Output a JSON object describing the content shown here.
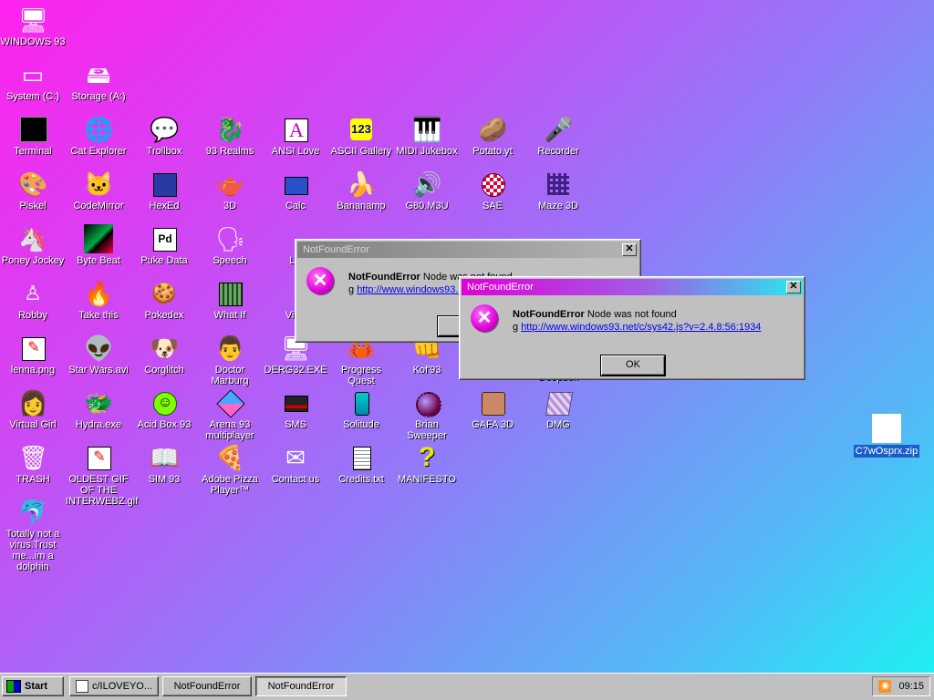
{
  "desktop": {
    "icons": [
      {
        "label": "WINDOWS 93",
        "glyph": "🖥"
      },
      {
        "label": "System (C:)",
        "glyph": "▭"
      },
      {
        "label": "Storage (A:)",
        "glyph": "🖴"
      },
      {
        "label": "Terminal",
        "glyph": "▮"
      },
      {
        "label": "Cat Explorer",
        "glyph": "🌐"
      },
      {
        "label": "Trollbox",
        "glyph": "💬"
      },
      {
        "label": "93 Realms",
        "glyph": "🐉"
      },
      {
        "label": "ANSI Love",
        "glyph": "A"
      },
      {
        "label": "ASCII Gallery",
        "glyph": "123"
      },
      {
        "label": "MIDI Jukebox",
        "glyph": "🎹"
      },
      {
        "label": "Potato.yt",
        "glyph": "🥔"
      },
      {
        "label": "Recorder",
        "glyph": "🎤"
      },
      {
        "label": "Piskel",
        "glyph": "🎨"
      },
      {
        "label": "CodeMirror",
        "glyph": "🐱"
      },
      {
        "label": "HexEd",
        "glyph": "⬢"
      },
      {
        "label": "3D",
        "glyph": "🫖"
      },
      {
        "label": "Calc",
        "glyph": "🖩"
      },
      {
        "label": "Bananamp",
        "glyph": "🍌"
      },
      {
        "label": "G80.M3U",
        "glyph": "🔊"
      },
      {
        "label": "SAE",
        "glyph": "⚽"
      },
      {
        "label": "Maze 3D",
        "glyph": "▦"
      },
      {
        "label": "Poney Jockey",
        "glyph": "🦄"
      },
      {
        "label": "Byte Beat",
        "glyph": "▩"
      },
      {
        "label": "Puke Data",
        "glyph": "Pd"
      },
      {
        "label": "Speech",
        "glyph": "🗣"
      },
      {
        "label": "LS",
        "glyph": "▣"
      },
      {
        "label": "Robby",
        "glyph": "🯅"
      },
      {
        "label": "Take this",
        "glyph": "🔥"
      },
      {
        "label": "Pokedex",
        "glyph": "🪙"
      },
      {
        "label": "What If",
        "glyph": "▥"
      },
      {
        "label": "Virtu",
        "glyph": "▢"
      },
      {
        "label": "lenna.png",
        "glyph": "🖼"
      },
      {
        "label": "Star Wars.avi",
        "glyph": "👽"
      },
      {
        "label": "Corglitch",
        "glyph": "🐶"
      },
      {
        "label": "Doctor Marburg",
        "glyph": "👨"
      },
      {
        "label": "DERG32.EXE",
        "glyph": "🖥"
      },
      {
        "label": "Progress Quest",
        "glyph": "🦀"
      },
      {
        "label": "Kof'93",
        "glyph": "👊"
      },
      {
        "label": "Deepbox",
        "glyph": ""
      },
      {
        "label": "Virtual Girl",
        "glyph": "👩"
      },
      {
        "label": "Hydra.exe",
        "glyph": "🐲"
      },
      {
        "label": "Acid Box 93",
        "glyph": "😃"
      },
      {
        "label": "Arena 93 multiplayer",
        "glyph": "🧊"
      },
      {
        "label": "SMS",
        "glyph": "▬"
      },
      {
        "label": "Solitude",
        "glyph": "🧴"
      },
      {
        "label": "Brian Sweeper",
        "glyph": "💣"
      },
      {
        "label": "GAFA 3D",
        "glyph": "🧟"
      },
      {
        "label": "DMG",
        "glyph": "▦"
      },
      {
        "label": "TRASH",
        "glyph": "🗑"
      },
      {
        "label": "OLDEST GIF OF THE INTERWEBZ.gif",
        "glyph": "🖼"
      },
      {
        "label": "SIM 93",
        "glyph": "📖"
      },
      {
        "label": "Adobe Pizza Player™",
        "glyph": "🍕"
      },
      {
        "label": "Contact us",
        "glyph": "✉"
      },
      {
        "label": "Credits.txt",
        "glyph": "📄"
      },
      {
        "label": "MANIFESTO",
        "glyph": "?"
      },
      {
        "label": "Totally not a virus.Trust me...im a dolphin",
        "glyph": "🐬"
      },
      {
        "label": "C7wOsprx.zip",
        "glyph": ""
      }
    ]
  },
  "dialogs": [
    {
      "title": "NotFoundError",
      "error_name": "NotFoundError",
      "message": "Node was not found",
      "link_prefix": "g ",
      "link": "http://www.windows93.net/c/sys42.js?v=2.4.8:56:1934",
      "ok": "OK"
    },
    {
      "title": "NotFoundError",
      "error_name": "NotFoundError",
      "message": "Node was not found",
      "link_prefix": "g ",
      "link": "http://www.windows93.net/c/sys42.js?v=2.4.8:56:1934",
      "ok": "OK"
    }
  ],
  "taskbar": {
    "start": "Start",
    "tasks": [
      {
        "label": "c/ILOVEYO..."
      },
      {
        "label": "NotFoundError"
      },
      {
        "label": "NotFoundError"
      }
    ],
    "clock": "09:15"
  },
  "colors": {
    "accent": "#e000d8",
    "title_active_end": "#24ecf0",
    "error_icon": "#e000d8",
    "link": "#0000ee"
  }
}
